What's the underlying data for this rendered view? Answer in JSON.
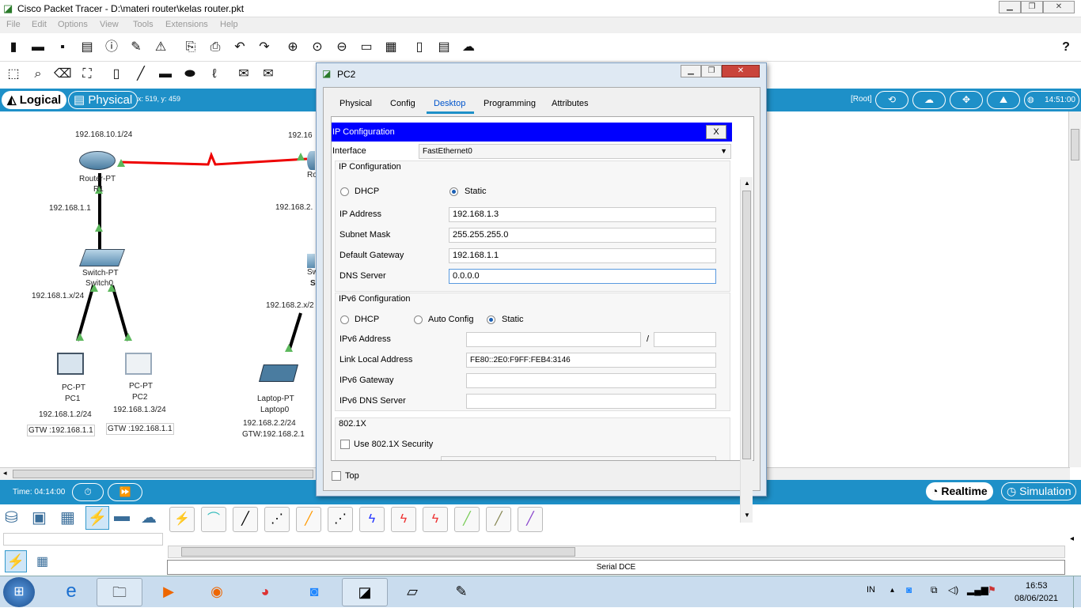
{
  "app": {
    "title": "Cisco Packet Tracer - D:\\materi router\\kelas router.pkt",
    "help": "?"
  },
  "menu": [
    "File",
    "Edit",
    "Options",
    "View",
    "Tools",
    "Extensions",
    "Help"
  ],
  "modebar": {
    "logical": "Logical",
    "physical": "Physical",
    "coords": "x: 519, y: 459",
    "root": "[Root]",
    "time": "14:51:00"
  },
  "topology": {
    "labels": {
      "r1_ip_top": "192.168.10.1/24",
      "r2_ip_top": "192.16",
      "r1_name": "Router-PT",
      "r1_id": "R1",
      "r2_id": "Ro",
      "r1_ip": "192.168.1.1",
      "r2_ip": "192.168.2.",
      "sw0_name": "Switch-PT",
      "sw0_id": "Switch0",
      "sw0_net": "192.168.1.x/24",
      "sw1_name": "Sw",
      "sw1_id": "S",
      "sw1_net": "192.168.2.x/2",
      "pc1_type": "PC-PT",
      "pc1_name": "PC1",
      "pc1_ip": "192.168.1.2/24",
      "pc1_gtw": "GTW :192.168.1.1",
      "pc2_type": "PC-PT",
      "pc2_name": "PC2",
      "pc2_ip": "192.168.1.3/24",
      "pc2_gtw": "GTW :192.168.1.1",
      "lap_type": "Laptop-PT",
      "lap_name": "Laptop0",
      "lap_ip": "192.168.2.2/24",
      "lap_gtw": "GTW:192.168.2.1"
    }
  },
  "bottombar": {
    "time": "Time: 04:14:00",
    "realtime": "Realtime",
    "simulation": "Simulation"
  },
  "devpanel": {
    "status": "Serial DCE"
  },
  "taskbar": {
    "lang": "IN",
    "clock": "16:53",
    "date": "08/06/2021"
  },
  "dialog": {
    "title": "PC2",
    "tabs": [
      "Physical",
      "Config",
      "Desktop",
      "Programming",
      "Attributes"
    ],
    "active_tab": "Desktop",
    "header": "IP Configuration",
    "close": "X",
    "interface_label": "Interface",
    "interface_value": "FastEthernet0",
    "ipv4": {
      "group": "IP Configuration",
      "dhcp": "DHCP",
      "static": "Static",
      "mode": "Static",
      "ip_label": "IP Address",
      "ip": "192.168.1.3",
      "mask_label": "Subnet Mask",
      "mask": "255.255.255.0",
      "gw_label": "Default Gateway",
      "gw": "192.168.1.1",
      "dns_label": "DNS Server",
      "dns": "0.0.0.0"
    },
    "ipv6": {
      "group": "IPv6 Configuration",
      "dhcp": "DHCP",
      "auto": "Auto Config",
      "static": "Static",
      "mode": "Static",
      "addr_label": "IPv6 Address",
      "addr": "",
      "slash": "/",
      "prefix": "",
      "ll_label": "Link Local Address",
      "ll": "FE80::2E0:F9FF:FEB4:3146",
      "gw_label": "IPv6 Gateway",
      "gw": "",
      "dns_label": "IPv6 DNS Server",
      "dns": ""
    },
    "dot1x": {
      "group": "802.1X",
      "use": "Use 802.1X Security"
    },
    "top_label": "Top"
  }
}
